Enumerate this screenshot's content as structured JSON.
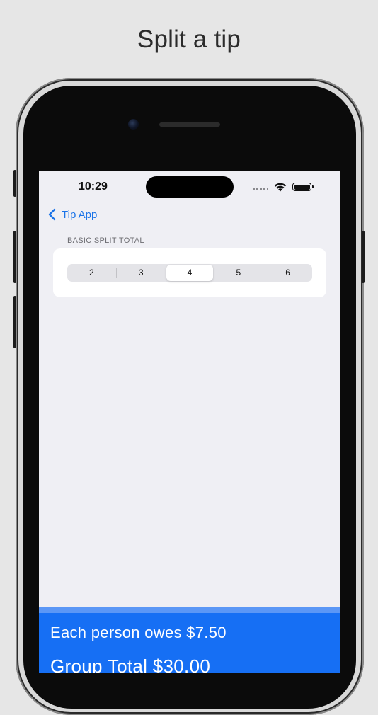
{
  "headline": "Split a tip",
  "status_bar": {
    "time": "10:29"
  },
  "nav": {
    "back_label": "Tip App"
  },
  "section": {
    "header": "BASIC SPLIT TOTAL"
  },
  "split_options": [
    "2",
    "3",
    "4",
    "5",
    "6"
  ],
  "selected_split": "4",
  "summary": {
    "each_person": "Each person owes $7.50",
    "group_total": "Group Total $30.00"
  },
  "colors": {
    "accent": "#1a73e8",
    "summary_bg": "#166ff4",
    "screen_bg": "#efeff4"
  }
}
